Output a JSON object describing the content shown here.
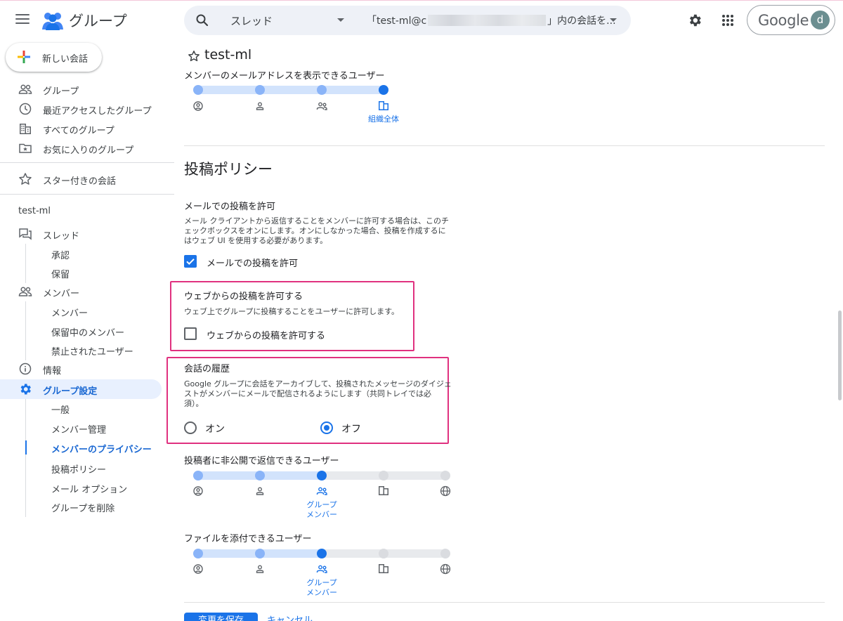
{
  "app": {
    "title": "グループ"
  },
  "search": {
    "scope": "スレッド",
    "query_prefix": "「test-ml@c",
    "query_suffix": "」内の会話を..."
  },
  "account": {
    "brand": "Google",
    "avatar_letter": "d"
  },
  "sidebar": {
    "new_conversation": "新しい会話",
    "primary": [
      {
        "label": "グループ",
        "icon": "people-icon"
      },
      {
        "label": "最近アクセスしたグループ",
        "icon": "clock-icon"
      },
      {
        "label": "すべてのグループ",
        "icon": "building-icon"
      },
      {
        "label": "お気に入りのグループ",
        "icon": "folder-star-icon"
      }
    ],
    "starred": "スター付きの会話",
    "group_name": "test-ml",
    "threads": {
      "label": "スレッド",
      "children": [
        "承認",
        "保留"
      ]
    },
    "members": {
      "label": "メンバー",
      "children": [
        "メンバー",
        "保留中のメンバー",
        "禁止されたユーザー"
      ]
    },
    "info": "情報",
    "settings": {
      "label": "グループ設定",
      "children": [
        "一般",
        "メンバー管理",
        "メンバーのプライバシー",
        "投稿ポリシー",
        "メール オプション",
        "グループを削除"
      ]
    }
  },
  "main": {
    "title": "test-ml",
    "email_visibility": {
      "label": "メンバーのメールアドレスを表示できるユーザー",
      "level": 4,
      "steps": 4,
      "selected_label": "組織全体"
    },
    "section_title": "投稿ポリシー",
    "email_posting": {
      "label": "メールでの投稿を許可",
      "description": [
        "メール クライアントから返信することをメンバーに許可する場合は、このチ",
        "ェックボックスをオンにします。オンにしなかった場合、投稿を作成するに",
        "はウェブ UI を使用する必要があります。"
      ],
      "checkbox_label": "メールでの投稿を許可",
      "checked": true
    },
    "web_posting": {
      "label": "ウェブからの投稿を許可する",
      "description": "ウェブ上でグループに投稿することをユーザーに許可します。",
      "checkbox_label": "ウェブからの投稿を許可する",
      "checked": false
    },
    "history": {
      "label": "会話の履歴",
      "description": [
        "Google グループに会話をアーカイブして、投稿されたメッセージのダイジェ",
        "ストがメンバーにメールで配信されるようにします（共同トレイでは必",
        "須）。"
      ],
      "on_label": "オン",
      "off_label": "オフ",
      "selected": "off"
    },
    "private_reply": {
      "label": "投稿者に非公開で返信できるユーザー",
      "level": 3,
      "steps": 5,
      "selected_label": [
        "グループ",
        "メンバー"
      ]
    },
    "attach_files": {
      "label": "ファイルを添付できるユーザー",
      "level": 3,
      "steps": 5,
      "selected_label": [
        "グループ",
        "メンバー"
      ]
    },
    "save_button": "変更を保存",
    "cancel_button": "キャンセル"
  },
  "colors": {
    "accent": "#1a73e8",
    "highlight": "#e0317f",
    "track": "#d2e3fc"
  }
}
